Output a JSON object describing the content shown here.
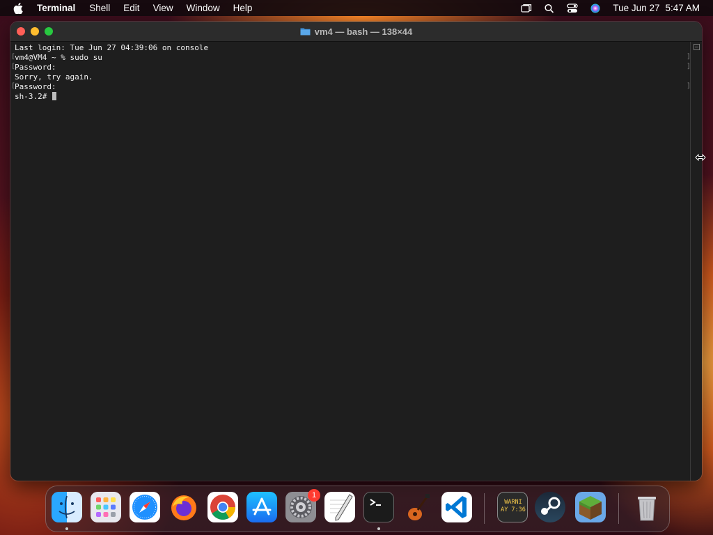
{
  "menubar": {
    "app_name": "Terminal",
    "menus": [
      "Shell",
      "Edit",
      "View",
      "Window",
      "Help"
    ],
    "date": "Tue Jun 27",
    "time": "5:47 AM"
  },
  "window": {
    "title": "vm4 — bash — 138×44",
    "lines": [
      "Last login: Tue Jun 27 04:39:06 on console",
      "vm4@VM4 ~ % sudo su",
      "Password:",
      "Sorry, try again.",
      "Password:",
      "sh-3.2# "
    ]
  },
  "dock": {
    "items": [
      "Finder",
      "Launchpad",
      "Safari",
      "Firefox",
      "Google Chrome",
      "App Store",
      "System Settings",
      "TextEdit",
      "Terminal",
      "GarageBand",
      "Visual Studio Code",
      "Console",
      "Steam",
      "Minecraft",
      "Trash"
    ],
    "settings_badge": "1",
    "console_text": "WARNI\nAY 7:36"
  },
  "colors": {
    "close": "#ff5f57",
    "minimize": "#febc2e",
    "maximize": "#28c840",
    "terminal_bg": "#1e1e1e"
  }
}
